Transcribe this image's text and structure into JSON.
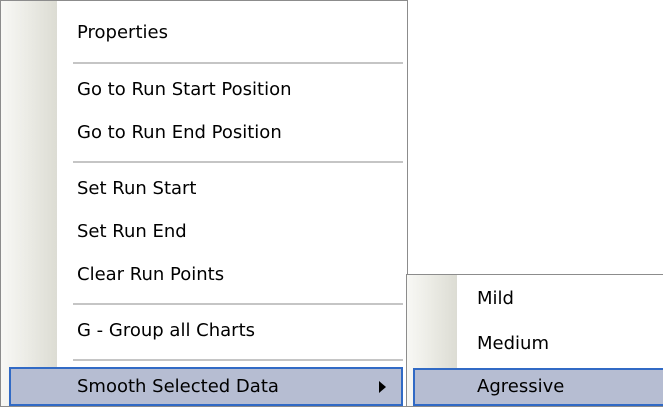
{
  "context_menu": {
    "items": [
      {
        "label": "Properties"
      },
      {
        "label": "Go to Run Start Position"
      },
      {
        "label": "Go to Run End Position"
      },
      {
        "label": "Set Run Start"
      },
      {
        "label": "Set Run End"
      },
      {
        "label": "Clear Run Points"
      },
      {
        "label": "G - Group all Charts"
      },
      {
        "label": "Smooth Selected Data",
        "has_submenu": true,
        "selected": true
      }
    ]
  },
  "submenu": {
    "items": [
      {
        "label": "Mild"
      },
      {
        "label": "Medium"
      },
      {
        "label": "Agressive",
        "selected": true
      }
    ]
  },
  "colors": {
    "selection_fill": "#b6bdd2",
    "selection_border": "#316ac5",
    "menu_border": "#8c8c8c",
    "gutter": "#e4e4dc"
  }
}
